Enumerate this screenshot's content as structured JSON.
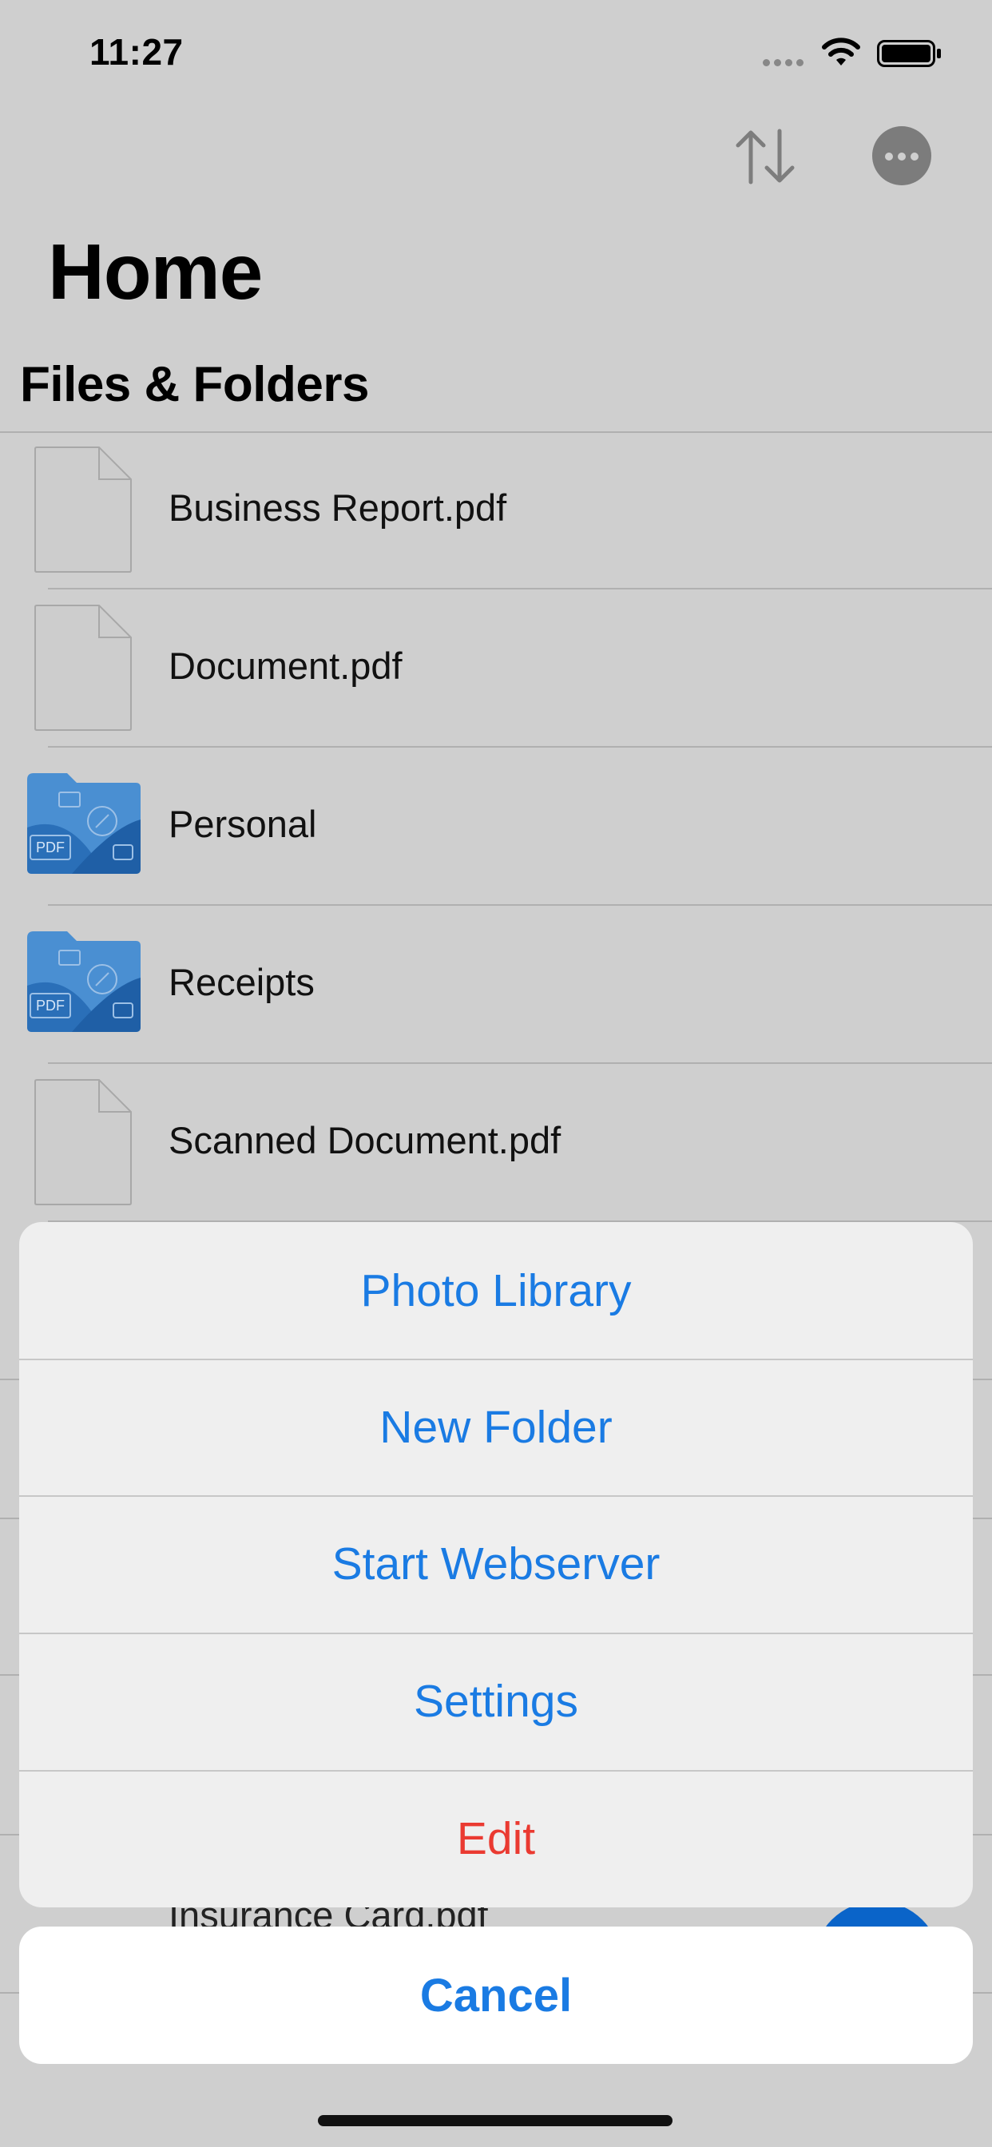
{
  "status_bar": {
    "time": "11:27"
  },
  "nav": {
    "title": "Home",
    "sort_icon": "sort-arrows-icon",
    "more_icon": "ellipsis-circle-icon"
  },
  "section": {
    "title": "Files & Folders"
  },
  "files": [
    {
      "name": "Business Report.pdf",
      "kind": "document"
    },
    {
      "name": "Document.pdf",
      "kind": "document"
    },
    {
      "name": "Personal",
      "kind": "folder"
    },
    {
      "name": "Receipts",
      "kind": "folder"
    },
    {
      "name": "Scanned Document.pdf",
      "kind": "document"
    }
  ],
  "partially_hidden_item": "Insurance Card.pdf",
  "folder_badge": "PDF",
  "action_sheet": {
    "actions": [
      {
        "label": "Photo Library",
        "style": "default"
      },
      {
        "label": "New Folder",
        "style": "default"
      },
      {
        "label": "Start Webserver",
        "style": "default"
      },
      {
        "label": "Settings",
        "style": "default"
      },
      {
        "label": "Edit",
        "style": "destructive"
      }
    ],
    "cancel_label": "Cancel"
  },
  "colors": {
    "accent": "#1a7be3",
    "destructive": "#ea3a31",
    "folder": "#2f7fd0",
    "dim_background": "#cfcfcf"
  }
}
